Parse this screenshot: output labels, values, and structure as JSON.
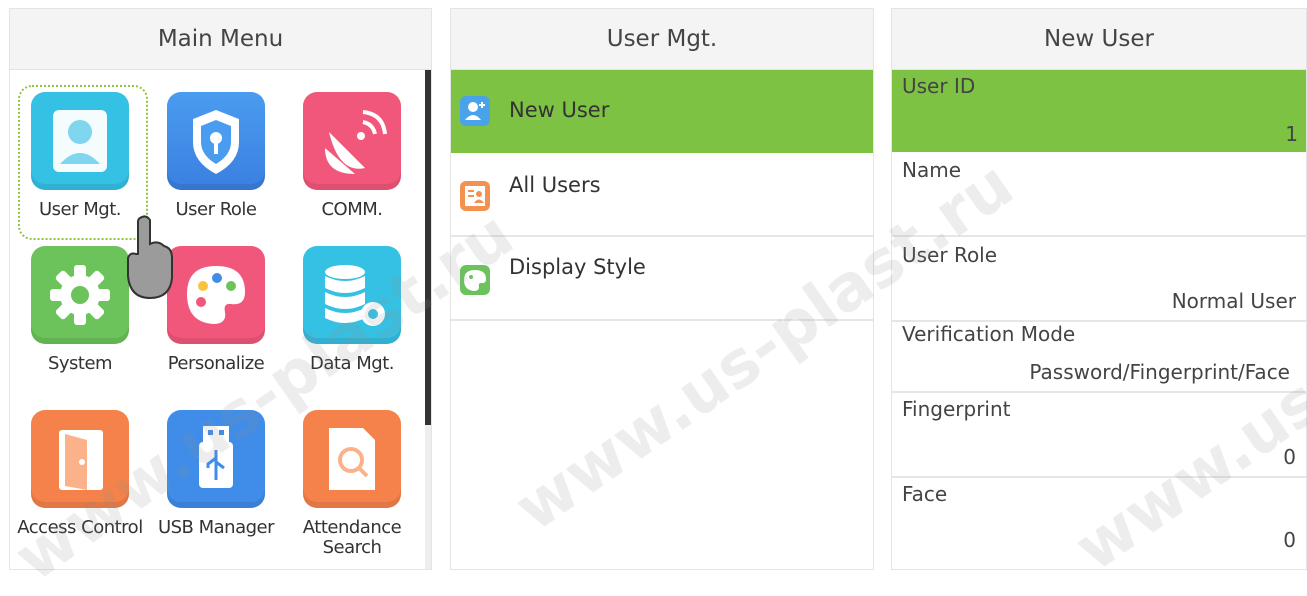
{
  "main_menu": {
    "title": "Main Menu",
    "items": [
      {
        "label": "User Mgt.",
        "icon": "user-icon",
        "color": "#35c1e4"
      },
      {
        "label": "User Role",
        "icon": "shield-key-icon",
        "color": "#3f8de8"
      },
      {
        "label": "COMM.",
        "icon": "satellite-dish-icon",
        "color": "#f0577a"
      },
      {
        "label": "System",
        "icon": "gear-icon",
        "color": "#6dc35b"
      },
      {
        "label": "Personalize",
        "icon": "palette-icon",
        "color": "#f0577a"
      },
      {
        "label": "Data Mgt.",
        "icon": "database-gear-icon",
        "color": "#35c1e4"
      },
      {
        "label": "Access Control",
        "icon": "door-icon",
        "color": "#f4824a"
      },
      {
        "label": "USB Manager",
        "icon": "usb-icon",
        "color": "#3f8de8"
      },
      {
        "label": "Attendance Search",
        "icon": "document-search-icon",
        "color": "#f4824a"
      }
    ]
  },
  "user_mgt": {
    "title": "User Mgt.",
    "items": [
      {
        "label": "New User",
        "icon": "new-user-icon"
      },
      {
        "label": "All Users",
        "icon": "all-users-icon"
      },
      {
        "label": "Display Style",
        "icon": "display-style-icon"
      }
    ]
  },
  "new_user": {
    "title": "New User",
    "fields": [
      {
        "label": "User ID",
        "value": "1"
      },
      {
        "label": "Name",
        "value": ""
      },
      {
        "label": "User Role",
        "value": "Normal User"
      },
      {
        "label": "Verification Mode",
        "value": "Password/Fingerprint/Face"
      },
      {
        "label": "Fingerprint",
        "value": "0"
      },
      {
        "label": "Face",
        "value": "0"
      }
    ]
  },
  "colors": {
    "accent": "#7dc242",
    "header_bg": "#f4f4f4"
  },
  "watermark": "www.us-plast.ru"
}
